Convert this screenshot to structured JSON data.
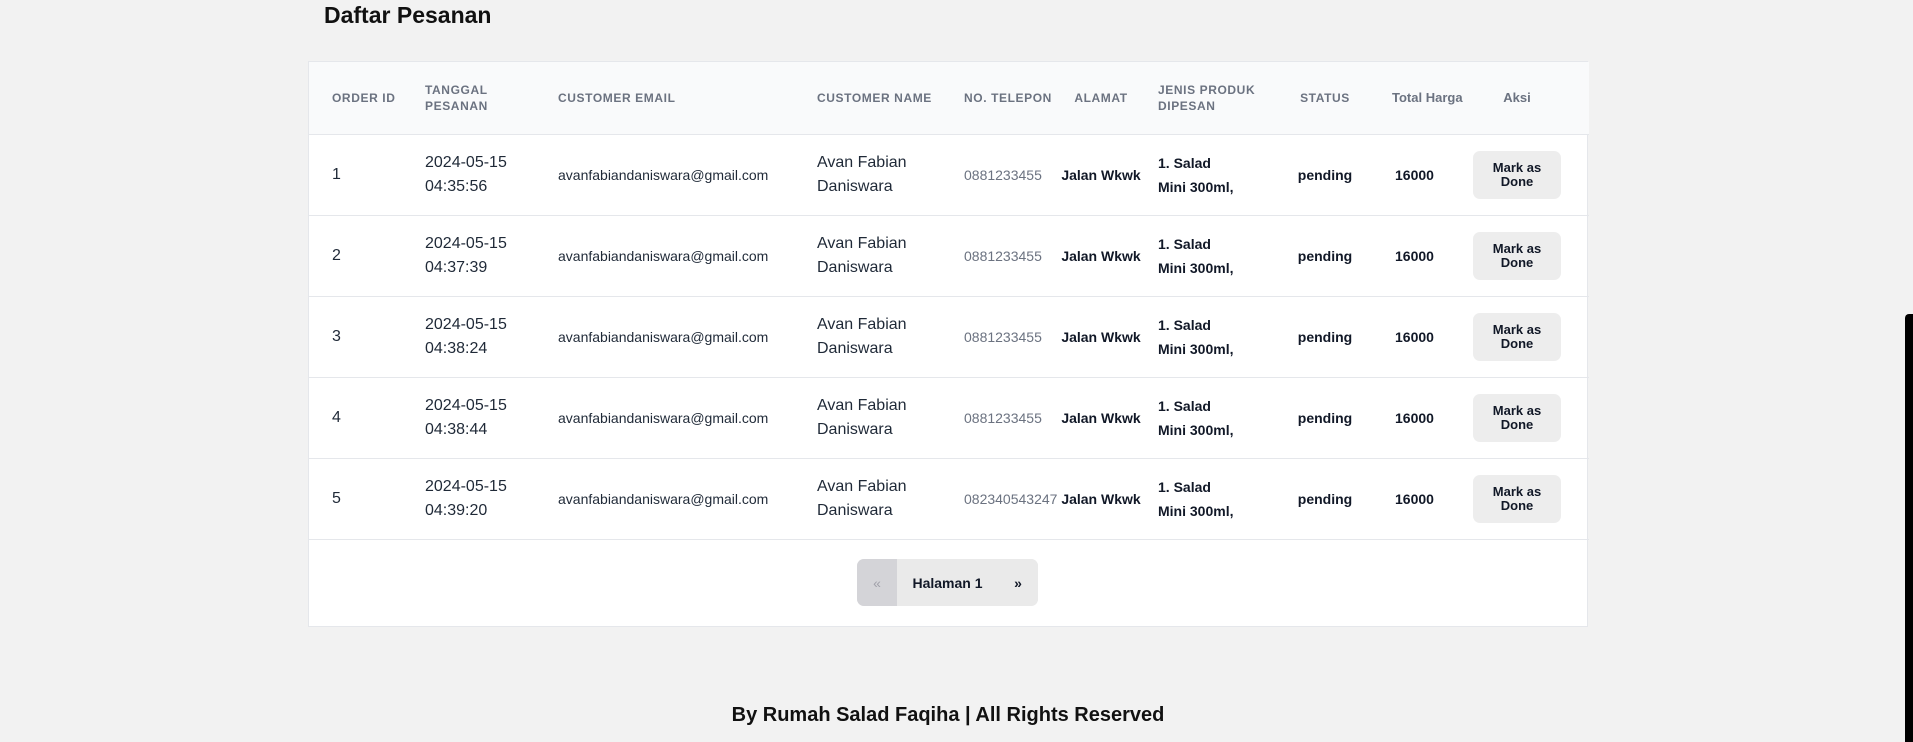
{
  "page": {
    "title": "Daftar Pesanan",
    "footer": "By Rumah Salad Faqiha | All Rights Reserved"
  },
  "table": {
    "headers": {
      "order_id": "Order ID",
      "tanggal": "Tanggal Pesanan",
      "email": "Customer Email",
      "name": "Customer Name",
      "phone": "No. Telepon",
      "alamat": "Alamat",
      "produk": "Jenis Produk Dipesan",
      "status": "Status",
      "total": "Total Harga",
      "aksi": "Aksi"
    },
    "rows": [
      {
        "id": "1",
        "date": "2024-05-15",
        "time": "04:35:56",
        "email": "avanfabiandaniswara@gmail.com",
        "name_first": "Avan Fabian",
        "name_last": "Daniswara",
        "phone": "0881233455",
        "alamat": "Jalan Wkwk",
        "produk_1": "1. Salad",
        "produk_2": "Mini 300ml,",
        "status": "pending",
        "total": "16000",
        "action": "Mark as Done"
      },
      {
        "id": "2",
        "date": "2024-05-15",
        "time": "04:37:39",
        "email": "avanfabiandaniswara@gmail.com",
        "name_first": "Avan Fabian",
        "name_last": "Daniswara",
        "phone": "0881233455",
        "alamat": "Jalan Wkwk",
        "produk_1": "1. Salad",
        "produk_2": "Mini 300ml,",
        "status": "pending",
        "total": "16000",
        "action": "Mark as Done"
      },
      {
        "id": "3",
        "date": "2024-05-15",
        "time": "04:38:24",
        "email": "avanfabiandaniswara@gmail.com",
        "name_first": "Avan Fabian",
        "name_last": "Daniswara",
        "phone": "0881233455",
        "alamat": "Jalan Wkwk",
        "produk_1": "1. Salad",
        "produk_2": "Mini 300ml,",
        "status": "pending",
        "total": "16000",
        "action": "Mark as Done"
      },
      {
        "id": "4",
        "date": "2024-05-15",
        "time": "04:38:44",
        "email": "avanfabiandaniswara@gmail.com",
        "name_first": "Avan Fabian",
        "name_last": "Daniswara",
        "phone": "0881233455",
        "alamat": "Jalan Wkwk",
        "produk_1": "1. Salad",
        "produk_2": "Mini 300ml,",
        "status": "pending",
        "total": "16000",
        "action": "Mark as Done"
      },
      {
        "id": "5",
        "date": "2024-05-15",
        "time": "04:39:20",
        "email": "avanfabiandaniswara@gmail.com",
        "name_first": "Avan Fabian",
        "name_last": "Daniswara",
        "phone": "082340543247",
        "alamat": "Jalan Wkwk",
        "produk_1": "1. Salad",
        "produk_2": "Mini 300ml,",
        "status": "pending",
        "total": "16000",
        "action": "Mark as Done"
      }
    ]
  },
  "pagination": {
    "prev": "«",
    "current": "Halaman 1",
    "next": "»"
  }
}
